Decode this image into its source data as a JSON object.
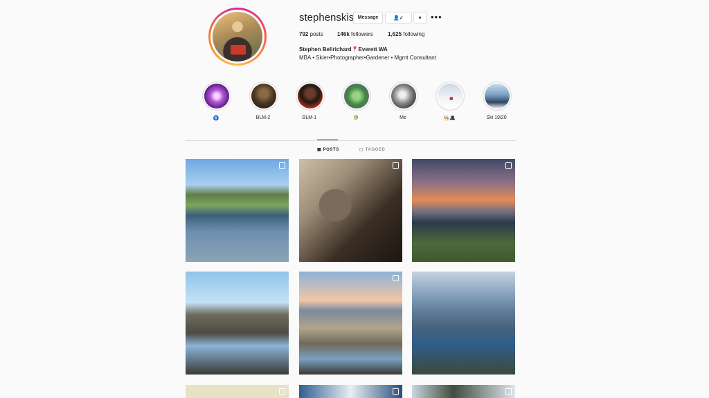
{
  "profile": {
    "username": "stephenskis",
    "message_label": "Message",
    "follow_icon_label": "👤✓",
    "dropdown_label": "▾",
    "more_label": "•••",
    "stats": {
      "posts_value": "792",
      "posts_label": "posts",
      "followers_value": "146k",
      "followers_label": "followers",
      "following_value": "1,625",
      "following_label": "following"
    },
    "full_name": "Stephen Bellrichard📍Everett WA",
    "bio": "MBA • Skier•Photographer•Gardener • Mgmt Consultant"
  },
  "highlights": [
    {
      "label": "🧿"
    },
    {
      "label": "BLM-2"
    },
    {
      "label": "BLM-1"
    },
    {
      "label": "🥬"
    },
    {
      "label": "Me"
    },
    {
      "label": "👨‍🍳🎩"
    },
    {
      "label": "Ski 19/20"
    }
  ],
  "tabs": {
    "posts": "POSTS",
    "tagged": "TAGGED"
  },
  "colors": {
    "background": "#fafafa",
    "border": "#dbdbdb",
    "text": "#262626",
    "muted": "#8e8e8e"
  }
}
